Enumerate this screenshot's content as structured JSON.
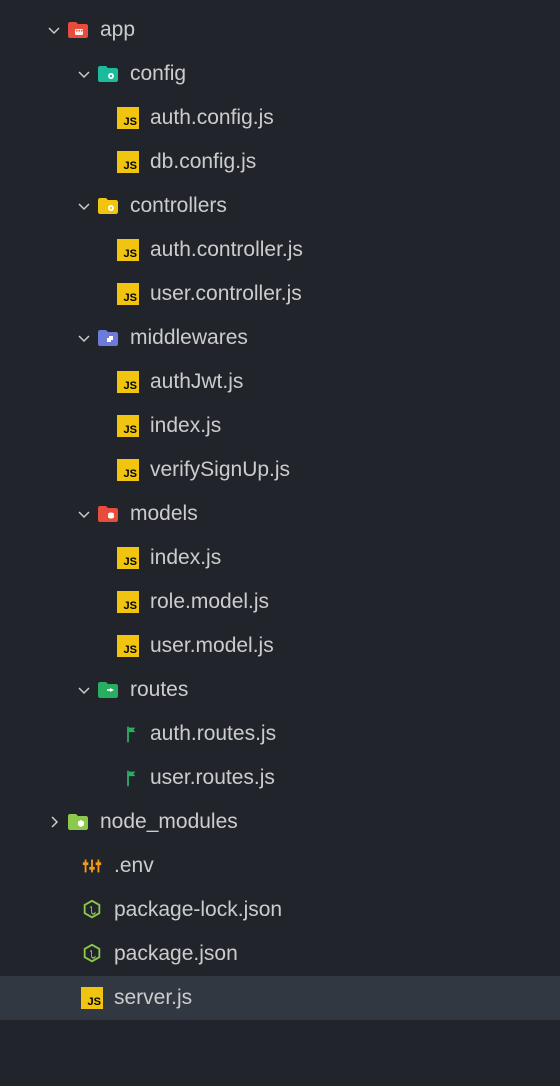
{
  "tree": {
    "app": {
      "label": "app",
      "config": {
        "label": "config",
        "files": [
          "auth.config.js",
          "db.config.js"
        ]
      },
      "controllers": {
        "label": "controllers",
        "files": [
          "auth.controller.js",
          "user.controller.js"
        ]
      },
      "middlewares": {
        "label": "middlewares",
        "files": [
          "authJwt.js",
          "index.js",
          "verifySignUp.js"
        ]
      },
      "models": {
        "label": "models",
        "files": [
          "index.js",
          "role.model.js",
          "user.model.js"
        ]
      },
      "routes": {
        "label": "routes",
        "files": [
          "auth.routes.js",
          "user.routes.js"
        ]
      }
    },
    "node_modules": {
      "label": "node_modules"
    },
    "env": {
      "label": ".env"
    },
    "package_lock": {
      "label": "package-lock.json"
    },
    "package_json": {
      "label": "package.json"
    },
    "server": {
      "label": "server.js"
    }
  }
}
